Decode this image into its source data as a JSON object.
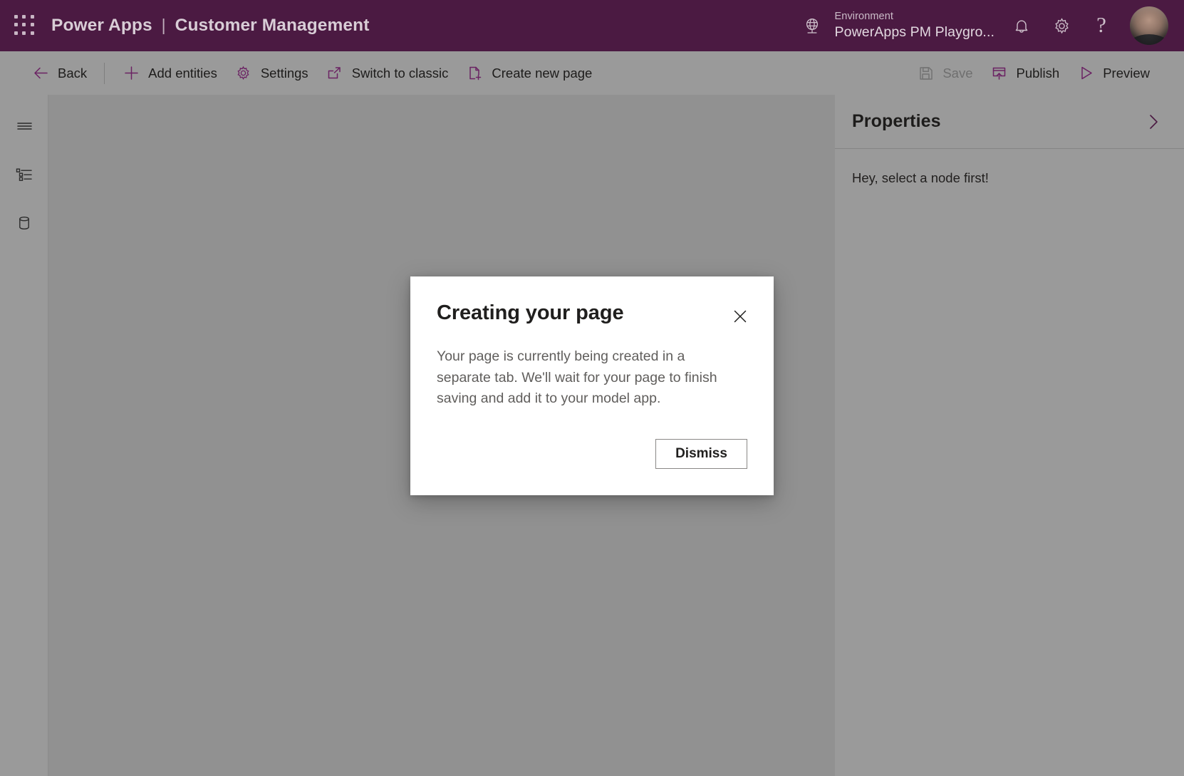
{
  "header": {
    "waffle_icon": "app-launcher-grid-icon",
    "product_name": "Power Apps",
    "separator": "|",
    "app_name": "Customer Management",
    "environment": {
      "icon": "globe-icon",
      "label": "Environment",
      "value": "PowerApps PM Playgro..."
    },
    "notifications_icon": "bell-icon",
    "settings_icon": "gear-icon",
    "help_icon": "question-mark-icon",
    "avatar": "user-avatar",
    "brand_color": "#4B1A42",
    "brand_text_color": "#D8CDD6"
  },
  "toolbar": {
    "back": {
      "label": "Back",
      "icon": "arrow-left-icon"
    },
    "add_entities": {
      "label": "Add entities",
      "icon": "plus-icon"
    },
    "settings": {
      "label": "Settings",
      "icon": "gear-icon"
    },
    "switch_to_classic": {
      "label": "Switch to classic",
      "icon": "external-link-icon"
    },
    "create_new_page": {
      "label": "Create new page",
      "icon": "new-page-icon"
    },
    "save": {
      "label": "Save",
      "icon": "floppy-disk-icon",
      "disabled": true
    },
    "publish": {
      "label": "Publish",
      "icon": "publish-upload-icon",
      "disabled": false
    },
    "preview": {
      "label": "Preview",
      "icon": "play-triangle-icon",
      "disabled": false
    },
    "accent_color": "#6B2263",
    "disabled_color": "#6F6F6F"
  },
  "rail": {
    "items": [
      {
        "name": "menu",
        "icon": "hamburger-menu-icon"
      },
      {
        "name": "navigation-tree",
        "icon": "tree-list-icon"
      },
      {
        "name": "data",
        "icon": "database-cylinder-icon"
      }
    ]
  },
  "properties_panel": {
    "title": "Properties",
    "collapse_icon": "chevron-right-icon",
    "empty_message": "Hey, select a node first!"
  },
  "modal": {
    "title": "Creating your page",
    "close_icon": "close-x-icon",
    "body": "Your page is currently being created in a separate tab. We'll wait for your page to finish saving and add it to your model app.",
    "dismiss_label": "Dismiss"
  }
}
